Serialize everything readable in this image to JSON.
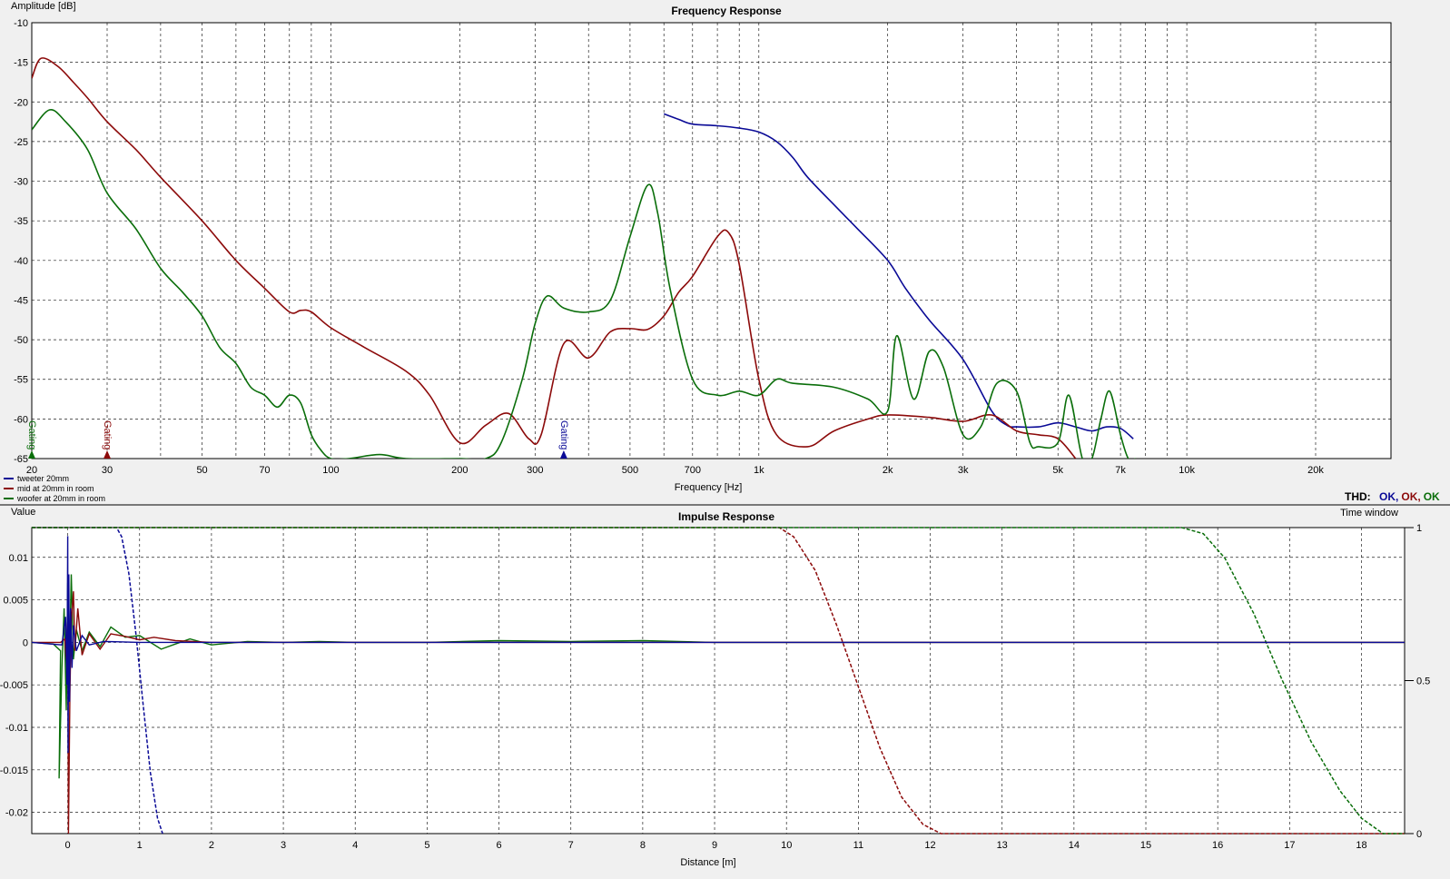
{
  "colors": {
    "tweeter": "#0a0a96",
    "mid": "#8c0a0a",
    "woofer": "#0a6e0a",
    "grid": "#222222",
    "plot_bg": "#ffffff",
    "panel_bg": "#f0f0f0"
  },
  "thd": {
    "label": "THD:",
    "tweeter": "OK,",
    "mid": "OK,",
    "woofer": "OK"
  },
  "gating_label": "Gating",
  "chart_data": [
    {
      "type": "line",
      "title": "Frequency Response",
      "xlabel": "Frequency [Hz]",
      "ylabel": "Amplitude [dB]",
      "xscale": "log",
      "xlim": [
        20,
        30000
      ],
      "ylim": [
        -65,
        -10
      ],
      "grid": true,
      "xticks": [
        {
          "v": 20,
          "label": "20"
        },
        {
          "v": 30,
          "label": "30"
        },
        {
          "v": 50,
          "label": "50"
        },
        {
          "v": 70,
          "label": "70"
        },
        {
          "v": 100,
          "label": "100"
        },
        {
          "v": 200,
          "label": "200"
        },
        {
          "v": 300,
          "label": "300"
        },
        {
          "v": 500,
          "label": "500"
        },
        {
          "v": 700,
          "label": "700"
        },
        {
          "v": 1000,
          "label": "1k"
        },
        {
          "v": 2000,
          "label": "2k"
        },
        {
          "v": 3000,
          "label": "3k"
        },
        {
          "v": 5000,
          "label": "5k"
        },
        {
          "v": 7000,
          "label": "7k"
        },
        {
          "v": 10000,
          "label": "10k"
        },
        {
          "v": 20000,
          "label": "20k"
        }
      ],
      "yticks": [
        -10,
        -15,
        -20,
        -25,
        -30,
        -35,
        -40,
        -45,
        -50,
        -55,
        -60,
        -65
      ],
      "legend_position": "bottom-left",
      "gating_markers": [
        {
          "series": "woofer at 20mm in room",
          "freq": 20
        },
        {
          "series": "mid at 20mm in room",
          "freq": 30
        },
        {
          "series": "tweeter 20mm",
          "freq": 350
        }
      ],
      "series": [
        {
          "name": "tweeter 20mm",
          "color": "#0a0a96",
          "x": [
            600,
            650,
            700,
            800,
            900,
            1000,
            1100,
            1200,
            1300,
            1500,
            1700,
            2000,
            2200,
            2500,
            3000,
            3500,
            3800,
            4000,
            4500,
            5000,
            5500,
            6000,
            6500,
            7000,
            7500
          ],
          "y": [
            -21.5,
            -22.2,
            -22.8,
            -23,
            -23.3,
            -23.8,
            -25,
            -27,
            -29.5,
            -33,
            -36,
            -40,
            -43.5,
            -47.5,
            -52.5,
            -59,
            -60.8,
            -61,
            -61,
            -60.5,
            -61,
            -61.5,
            -61,
            -61.2,
            -62.5
          ]
        },
        {
          "name": "mid at 20mm in room",
          "color": "#8c0a0a",
          "x": [
            20,
            21,
            23,
            25,
            27,
            30,
            35,
            40,
            50,
            60,
            70,
            80,
            85,
            90,
            100,
            120,
            150,
            170,
            200,
            230,
            260,
            290,
            310,
            350,
            400,
            450,
            500,
            550,
            600,
            650,
            700,
            800,
            850,
            900,
            1000,
            1100,
            1300,
            1500,
            1800,
            2000,
            2500,
            3000,
            3500,
            4000,
            4500,
            5000,
            5500
          ],
          "y": [
            -17,
            -14.5,
            -15.5,
            -17.5,
            -19.5,
            -22.5,
            -26,
            -29.5,
            -35,
            -40,
            -43.5,
            -46.5,
            -46.3,
            -46.5,
            -48.5,
            -51,
            -54,
            -57,
            -63,
            -60.8,
            -59.3,
            -62.5,
            -62,
            -50.5,
            -52.3,
            -49,
            -48.6,
            -48.7,
            -47,
            -44,
            -42,
            -37,
            -36.5,
            -40.5,
            -55,
            -62,
            -63.5,
            -61.5,
            -60,
            -59.5,
            -59.8,
            -60.3,
            -59.5,
            -61.5,
            -62,
            -62.5,
            -65
          ]
        },
        {
          "name": "woofer at 20mm in room",
          "color": "#0a6e0a",
          "x": [
            20,
            22,
            24,
            27,
            30,
            35,
            40,
            45,
            50,
            55,
            60,
            65,
            70,
            75,
            80,
            85,
            90,
            95,
            100,
            110,
            130,
            150,
            200,
            230,
            250,
            280,
            300,
            320,
            350,
            400,
            450,
            500,
            550,
            580,
            620,
            700,
            800,
            900,
            1000,
            1100,
            1200,
            1500,
            1800,
            2000,
            2100,
            2300,
            2500,
            2700,
            3000,
            3300,
            3600,
            4000,
            4300,
            4500,
            5000,
            5300,
            5700,
            6000,
            6300,
            6600,
            7000,
            7300,
            7600
          ],
          "y": [
            -23.5,
            -21,
            -22.5,
            -26,
            -31.5,
            -36,
            -41,
            -44,
            -47,
            -51,
            -53,
            -56,
            -57,
            -58.5,
            -57,
            -58,
            -62,
            -64,
            -65,
            -65,
            -64.5,
            -65,
            -65,
            -65,
            -63,
            -55,
            -48,
            -44.5,
            -46,
            -46.5,
            -45,
            -37,
            -30.5,
            -34,
            -43.5,
            -55,
            -57,
            -56.5,
            -57,
            -55,
            -55.5,
            -56,
            -57.5,
            -59,
            -49.5,
            -57.5,
            -51.5,
            -53.5,
            -62,
            -61,
            -55.5,
            -56.5,
            -63,
            -63.5,
            -63,
            -57,
            -65,
            -65,
            -60,
            -56.5,
            -62,
            -65,
            -65
          ]
        }
      ]
    },
    {
      "type": "line",
      "title": "Impulse Response",
      "xlabel": "Distance [m]",
      "ylabel": "Value",
      "y2label": "Time window",
      "xlim": [
        -0.5,
        18.6
      ],
      "ylim": [
        -0.0225,
        0.0135
      ],
      "y2lim": [
        0,
        1
      ],
      "grid": true,
      "xticks": [
        0,
        1,
        2,
        3,
        4,
        5,
        6,
        7,
        8,
        9,
        10,
        11,
        12,
        13,
        14,
        15,
        16,
        17,
        18
      ],
      "yticks": [
        {
          "v": 0.01,
          "label": "0.01"
        },
        {
          "v": 0.005,
          "label": "0.005"
        },
        {
          "v": 0,
          "label": "0"
        },
        {
          "v": -0.005,
          "label": "-0.005"
        },
        {
          "v": -0.01,
          "label": "-0.01"
        },
        {
          "v": -0.015,
          "label": "-0.015"
        },
        {
          "v": -0.02,
          "label": "-0.02"
        }
      ],
      "y2ticks": [
        {
          "v": 1,
          "label": "1"
        },
        {
          "v": 0.5,
          "label": "0.5"
        },
        {
          "v": 0,
          "label": "0"
        }
      ],
      "series": [
        {
          "name": "woofer at 20mm in room",
          "color": "#0a6e0a",
          "x": [
            -0.5,
            -0.2,
            -0.1,
            -0.12,
            -0.08,
            -0.05,
            -0.02,
            0,
            0.02,
            0.05,
            0.08,
            0.12,
            0.2,
            0.3,
            0.45,
            0.6,
            0.8,
            1.0,
            1.3,
            1.5,
            1.7,
            2,
            2.5,
            3,
            3.5,
            4,
            5,
            6,
            7,
            8,
            9,
            10,
            12,
            14,
            16,
            18.6
          ],
          "y": [
            0,
            -0.0002,
            -0.001,
            -0.016,
            -0.003,
            0.004,
            -0.008,
            0.007,
            -0.004,
            0.008,
            -0.002,
            0.0015,
            -0.001,
            0.0012,
            -0.0005,
            0.0018,
            0.0006,
            0.0008,
            -0.0008,
            -0.0002,
            0.0004,
            -0.0003,
            0.0001,
            0,
            0.0001,
            0,
            0,
            0.0002,
            0.0001,
            0.0002,
            0,
            0,
            0,
            0,
            0,
            0
          ]
        },
        {
          "name": "mid at 20mm in room",
          "color": "#8c0a0a",
          "x": [
            -0.5,
            -0.1,
            -0.04,
            -0.02,
            0,
            0.01,
            0.03,
            0.05,
            0.08,
            0.1,
            0.14,
            0.2,
            0.3,
            0.45,
            0.6,
            0.8,
            1.0,
            1.2,
            1.5,
            2,
            2.5,
            3,
            4,
            5,
            6,
            7,
            8,
            10,
            12,
            14,
            16,
            18.6
          ],
          "y": [
            0,
            0,
            0.0004,
            -0.002,
            0.004,
            -0.0225,
            -0.006,
            0.0025,
            0.006,
            -0.001,
            0.004,
            -0.0015,
            0.001,
            -0.0008,
            0.001,
            0.0007,
            0.0003,
            0.0006,
            0.0002,
            0,
            0,
            0,
            0,
            0,
            0,
            0,
            0,
            0,
            0,
            0,
            0,
            0
          ]
        },
        {
          "name": "tweeter 20mm",
          "color": "#0a0a96",
          "x": [
            -0.5,
            -0.08,
            -0.03,
            -0.01,
            0,
            0.005,
            0.015,
            0.025,
            0.04,
            0.06,
            0.08,
            0.12,
            0.2,
            0.3,
            0.5,
            1,
            2,
            4,
            6,
            8,
            10,
            12,
            14,
            16,
            18.6
          ],
          "y": [
            0,
            -0.0003,
            0.003,
            -0.005,
            0.0125,
            -0.013,
            0.008,
            -0.007,
            0.004,
            -0.003,
            0.002,
            -0.001,
            0.0008,
            -0.0003,
            0.0001,
            0,
            0,
            0,
            0,
            0,
            0,
            0,
            0,
            0,
            0
          ]
        }
      ],
      "time_windows": [
        {
          "name": "tweeter 20mm",
          "color": "#0a0a96",
          "x": [
            -0.5,
            0.68,
            0.75,
            0.85,
            0.95,
            1.05,
            1.15,
            1.25,
            1.32
          ],
          "y": [
            1,
            1,
            0.97,
            0.85,
            0.65,
            0.42,
            0.2,
            0.05,
            0
          ]
        },
        {
          "name": "mid at 20mm in room",
          "color": "#8c0a0a",
          "x": [
            -0.5,
            9.9,
            10.1,
            10.4,
            10.7,
            11.0,
            11.3,
            11.6,
            11.9,
            12.15,
            18.6
          ],
          "y": [
            1,
            1,
            0.97,
            0.86,
            0.68,
            0.48,
            0.28,
            0.12,
            0.03,
            0,
            0
          ]
        },
        {
          "name": "woofer at 20mm in room",
          "color": "#0a6e0a",
          "x": [
            -0.5,
            15.5,
            15.8,
            16.1,
            16.5,
            16.9,
            17.3,
            17.7,
            18.0,
            18.3,
            18.6
          ],
          "y": [
            1,
            1,
            0.98,
            0.9,
            0.72,
            0.5,
            0.3,
            0.14,
            0.05,
            0,
            0
          ]
        }
      ]
    }
  ]
}
